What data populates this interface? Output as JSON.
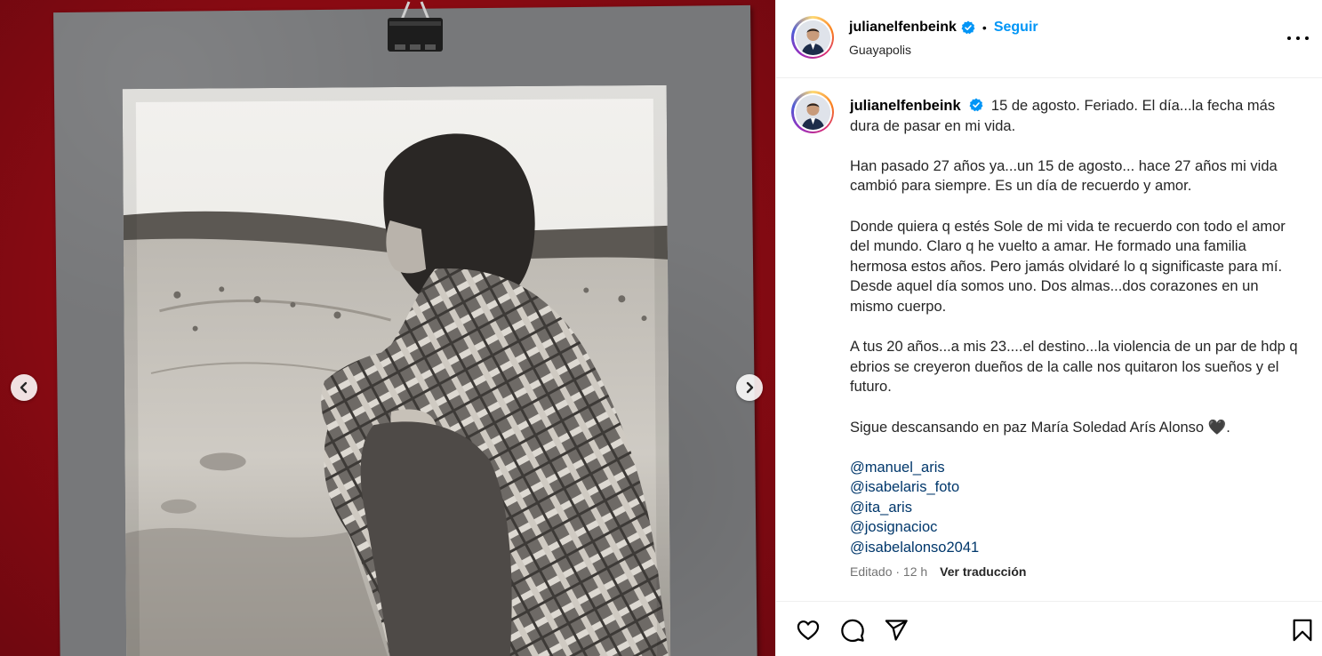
{
  "post": {
    "media": {
      "prev_icon": "chevron-left-icon",
      "next_icon": "chevron-right-icon"
    },
    "header": {
      "username": "julianelfenbeink",
      "verified_icon": "verified-badge-icon",
      "separator": "•",
      "follow_label": "Seguir",
      "location": "Guayapolis",
      "more_icon": "more-options-icon"
    },
    "caption": {
      "username": "julianelfenbeink",
      "paragraphs": [
        "15 de agosto. Feriado. El día...la fecha más dura de pasar en mi vida.",
        "Han pasado 27 años ya...un 15 de agosto... hace 27 años mi vida cambió para siempre. Es un día de recuerdo y amor.",
        "Donde quiera q estés Sole de mi vida te recuerdo con todo el amor del mundo. Claro q he vuelto a amar. He formado una familia hermosa estos años. Pero jamás olvidaré lo q significaste para mí. Desde aquel día somos uno. Dos almas...dos corazones en un mismo cuerpo.",
        "A tus 20 años...a mis 23....el destino...la violencia de un par de hdp q ebrios se creyeron dueños de la calle nos quitaron los sueños y el futuro.",
        "Sigue descansando en paz María Soledad Arís Alonso 🖤."
      ],
      "mentions": [
        "@manuel_aris",
        "@isabelaris_foto",
        "@ita_aris",
        "@josignacioc",
        "@isabelalonso2041"
      ]
    },
    "meta": {
      "edited": "Editado · 12 h",
      "translate": "Ver traducción"
    },
    "actions": {
      "like_icon": "heart-icon",
      "comment_icon": "comment-icon",
      "share_icon": "share-icon",
      "save_icon": "bookmark-icon"
    },
    "colors": {
      "follow": "#0095f6",
      "mention": "#00376b",
      "background_red": "#8b0a12"
    }
  }
}
